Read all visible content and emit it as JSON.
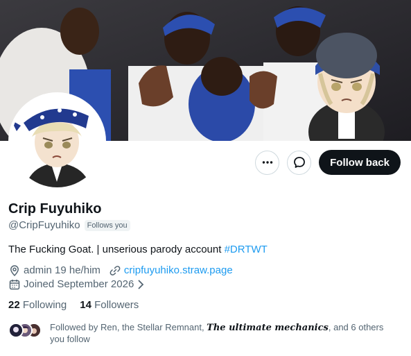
{
  "profile": {
    "display_name": "Crip Fuyuhiko",
    "handle": "@CripFuyuhiko",
    "follows_you_badge": "Follows you",
    "bio_text": "The Fucking Goat. | unserious parody account ",
    "bio_hashtag": "#DRTWT",
    "location": "admin 19 he/him",
    "website": "cripfuyuhiko.straw.page",
    "joined": "Joined September 2026"
  },
  "actions": {
    "more_icon": "more-icon",
    "message_icon": "message-icon",
    "follow_label": "Follow back"
  },
  "stats": {
    "following_count": "22",
    "following_label": "Following",
    "followers_count": "14",
    "followers_label": "Followers"
  },
  "followed_by": {
    "prefix": "Followed by Ren, the Stellar Remnant, ",
    "fancy_name": "The ultimate mechanics",
    "suffix": ", and 6 others you follow"
  },
  "colors": {
    "accent": "#1d9bf0",
    "follow_button": "#0f1419",
    "muted": "#536471"
  }
}
